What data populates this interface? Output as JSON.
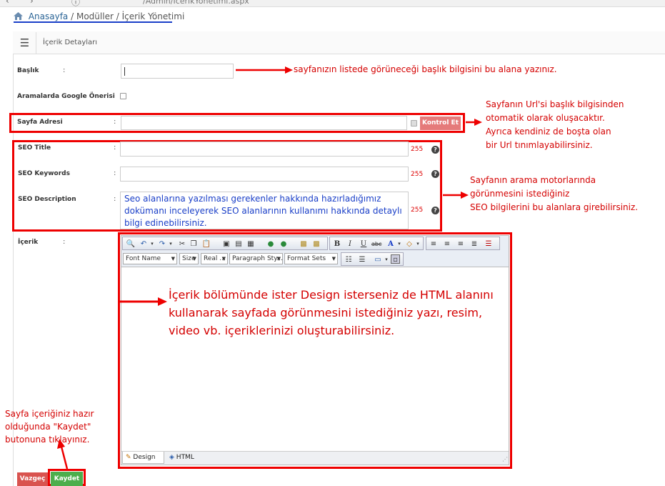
{
  "browser": {
    "url": "/Admin/IcerikYonetimi.aspx"
  },
  "breadcrumb": {
    "home": "Anasayfa",
    "separator": "/",
    "modules": "Modüller",
    "page": "İçerik Yönetimi"
  },
  "panel": {
    "title": "İçerik Detayları"
  },
  "form": {
    "title_label": "Başlık",
    "google_label": "Aramalarda Google Önerisi",
    "url_label": "Sayfa Adresi",
    "check_button": "Kontrol Et",
    "seo_title_label": "SEO Title",
    "seo_keywords_label": "SEO Keywords",
    "seo_description_label": "SEO Description",
    "content_label": "İçerik",
    "colon": ":",
    "limit_title": "255",
    "limit_keywords": "255",
    "limit_description": "255",
    "seo_description_value": "Seo alanlarına yazılması gerekenler hakkında hazırladığımız dokümanı inceleyerek SEO alanlarının kullanımı hakkında detaylı bilgi edinebilirsiniz."
  },
  "editor": {
    "font_name": "Font Name",
    "size": "Size",
    "real": "Real ...",
    "paragraph": "Paragraph Sty...",
    "format_sets": "Format Sets",
    "tab_design": "Design",
    "tab_html": "HTML",
    "body_text": "İçerik bölümünde ister Design isterseniz de HTML alanını kullanarak sayfada görünmesini istediğiniz yazı, resim, video vb. içeriklerinizi oluşturabilirsiniz."
  },
  "buttons": {
    "cancel": "Vazgeç",
    "save": "Kaydet"
  },
  "annotations": {
    "title_note": "sayfanızın listede görüneceği başlık bilgisini bu alana yazınız.",
    "url_note_1": "Sayfanın Url'si başlık bilgisinden",
    "url_note_2": "otomatik olarak oluşacaktır.",
    "url_note_3": "Ayrıca kendiniz de boşta olan",
    "url_note_4": "bir Url tınımlayabilirsiniz.",
    "seo_note_1": "Sayfanın arama motorlarında",
    "seo_note_2": "görünmesini istediğiniz",
    "seo_note_3": "SEO bilgilerini bu alanlara girebilirsiniz.",
    "save_note_1": "Sayfa içeriğiniz hazır",
    "save_note_2": "olduğunda \"Kaydet\"",
    "save_note_3": "butonuna tıklayınız."
  },
  "colors": {
    "annotation": "#d40000",
    "link": "#1a3fc8",
    "save": "#4cae4c",
    "cancel": "#d9534f"
  }
}
